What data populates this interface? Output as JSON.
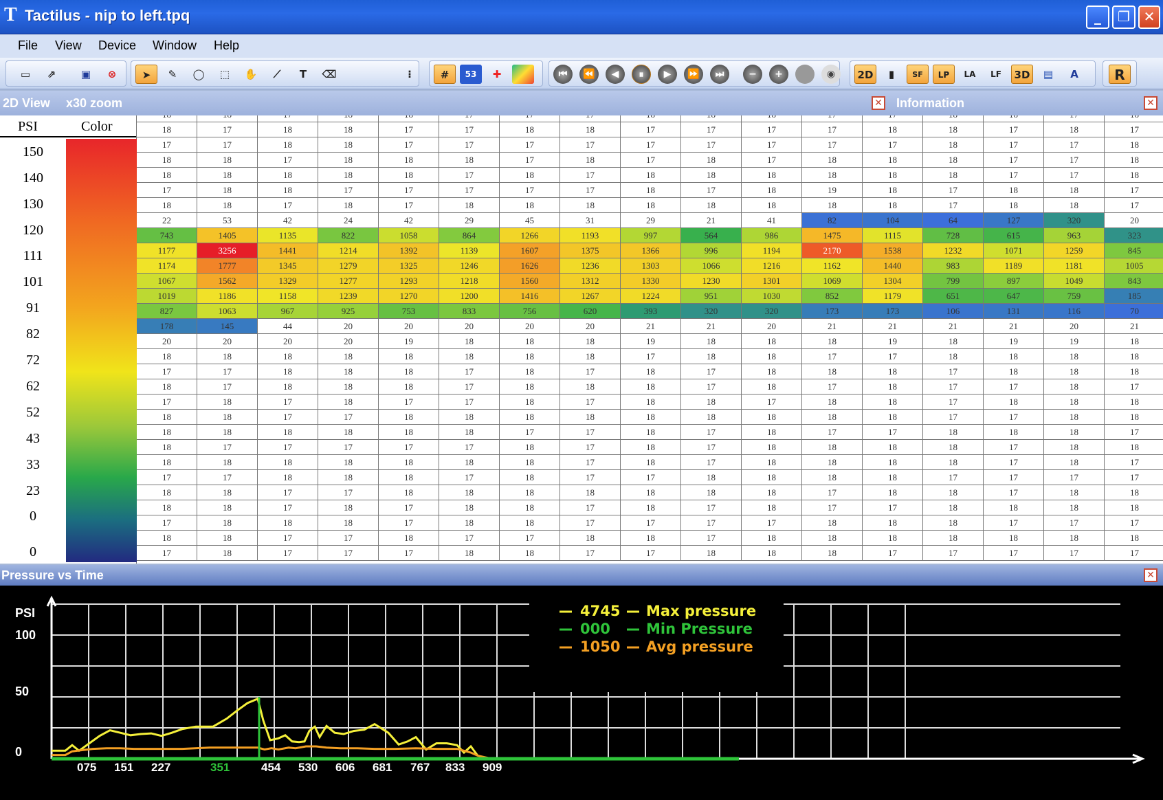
{
  "window": {
    "logo": "T",
    "title": "Tactilus - nip to left.tpq",
    "min_label": "_",
    "max_label": "❐",
    "close_label": "✕"
  },
  "menu": [
    "File",
    "View",
    "Device",
    "Window",
    "Help"
  ],
  "toolbar": {
    "file_tools": [
      "new-icon",
      "open-icon",
      "save-icon",
      "stop-icon"
    ],
    "draw_tools": [
      "pointer-icon",
      "pencil-icon",
      "ellipse-icon",
      "rect-select-icon",
      "hand-icon",
      "line-tool-icon",
      "text-tool-icon",
      "eraser-icon"
    ],
    "view_tools": [
      "grid-icon",
      "numbers-icon",
      "crosshair-icon",
      "colormap-icon"
    ],
    "play_tools": [
      "first-icon",
      "rewind-icon",
      "back-icon",
      "pause-icon",
      "play-icon",
      "forward-icon",
      "last-icon",
      "step-back-icon",
      "step-forward-icon",
      "record-icon",
      "eye-icon"
    ],
    "mode_tools": [
      "2D",
      "bar",
      "SF",
      "LP",
      "LA",
      "LF",
      "3D",
      "img",
      "A"
    ],
    "right_tool": "R"
  },
  "panels": {
    "view_title": "2D View",
    "zoom": "x30 zoom",
    "info_title": "Information",
    "close": "✕"
  },
  "legend": {
    "psi_header": "PSI",
    "color_header": "Color",
    "ticks": [
      "150",
      "140",
      "130",
      "120",
      "111",
      "101",
      "91",
      "82",
      "72",
      "62",
      "52",
      "43",
      "33",
      "23",
      "0",
      "0"
    ],
    "colors": [
      "#e8262a",
      "#f06a22",
      "#f3a61e",
      "#f0e41a",
      "#9bc83a",
      "#29a84a",
      "#1b6e80",
      "#222a80"
    ]
  },
  "grid": {
    "rows": [
      [
        "18",
        "18",
        "17",
        "18",
        "18",
        "17",
        "17",
        "17",
        "18",
        "18",
        "18",
        "17",
        "17",
        "18",
        "18",
        "17",
        "18"
      ],
      [
        "18",
        "17",
        "18",
        "18",
        "17",
        "17",
        "18",
        "18",
        "17",
        "17",
        "17",
        "17",
        "18",
        "18",
        "17",
        "18",
        "17"
      ],
      [
        "17",
        "17",
        "18",
        "18",
        "17",
        "17",
        "17",
        "17",
        "17",
        "17",
        "17",
        "17",
        "17",
        "18",
        "17",
        "17",
        "18"
      ],
      [
        "18",
        "18",
        "17",
        "18",
        "18",
        "18",
        "17",
        "18",
        "17",
        "18",
        "17",
        "18",
        "18",
        "18",
        "17",
        "17",
        "18"
      ],
      [
        "18",
        "18",
        "18",
        "18",
        "18",
        "17",
        "18",
        "17",
        "18",
        "18",
        "18",
        "18",
        "18",
        "18",
        "17",
        "17",
        "18"
      ],
      [
        "17",
        "18",
        "18",
        "17",
        "17",
        "17",
        "17",
        "17",
        "18",
        "17",
        "18",
        "19",
        "18",
        "17",
        "18",
        "18",
        "17"
      ],
      [
        "18",
        "18",
        "17",
        "18",
        "17",
        "18",
        "18",
        "18",
        "18",
        "18",
        "18",
        "18",
        "18",
        "17",
        "18",
        "18",
        "17"
      ],
      [
        "22",
        "53",
        "42",
        "24",
        "42",
        "29",
        "45",
        "31",
        "29",
        "21",
        "41",
        "82",
        "104",
        "64",
        "127",
        "320",
        "20"
      ],
      [
        "743",
        "1405",
        "1135",
        "822",
        "1058",
        "864",
        "1266",
        "1193",
        "997",
        "564",
        "986",
        "1475",
        "1115",
        "728",
        "615",
        "963",
        "323"
      ],
      [
        "1177",
        "3256",
        "1441",
        "1214",
        "1392",
        "1139",
        "1607",
        "1375",
        "1366",
        "996",
        "1194",
        "2170",
        "1538",
        "1232",
        "1071",
        "1259",
        "845"
      ],
      [
        "1174",
        "1777",
        "1345",
        "1279",
        "1325",
        "1246",
        "1626",
        "1236",
        "1303",
        "1066",
        "1216",
        "1162",
        "1440",
        "983",
        "1189",
        "1181",
        "1005"
      ],
      [
        "1067",
        "1562",
        "1329",
        "1277",
        "1293",
        "1218",
        "1560",
        "1312",
        "1330",
        "1230",
        "1301",
        "1069",
        "1304",
        "799",
        "897",
        "1049",
        "843"
      ],
      [
        "1019",
        "1186",
        "1158",
        "1239",
        "1270",
        "1200",
        "1416",
        "1267",
        "1224",
        "951",
        "1030",
        "852",
        "1179",
        "651",
        "647",
        "759",
        "185"
      ],
      [
        "827",
        "1063",
        "967",
        "925",
        "753",
        "833",
        "756",
        "620",
        "393",
        "320",
        "320",
        "173",
        "173",
        "106",
        "131",
        "116",
        "70"
      ],
      [
        "178",
        "145",
        "44",
        "20",
        "20",
        "20",
        "20",
        "20",
        "21",
        "21",
        "20",
        "21",
        "21",
        "21",
        "21",
        "20",
        "21"
      ],
      [
        "20",
        "20",
        "20",
        "20",
        "19",
        "18",
        "18",
        "18",
        "19",
        "18",
        "18",
        "18",
        "19",
        "18",
        "19",
        "19",
        "18"
      ],
      [
        "18",
        "18",
        "18",
        "18",
        "18",
        "18",
        "18",
        "18",
        "17",
        "18",
        "18",
        "17",
        "17",
        "18",
        "18",
        "18",
        "18"
      ],
      [
        "17",
        "17",
        "18",
        "18",
        "18",
        "17",
        "18",
        "17",
        "18",
        "17",
        "18",
        "18",
        "18",
        "17",
        "18",
        "18",
        "18"
      ],
      [
        "18",
        "17",
        "18",
        "18",
        "18",
        "17",
        "18",
        "18",
        "18",
        "17",
        "18",
        "17",
        "18",
        "17",
        "17",
        "18",
        "17"
      ],
      [
        "17",
        "18",
        "17",
        "18",
        "17",
        "17",
        "18",
        "17",
        "18",
        "18",
        "17",
        "18",
        "18",
        "17",
        "18",
        "18",
        "18"
      ],
      [
        "18",
        "18",
        "17",
        "17",
        "18",
        "18",
        "18",
        "18",
        "18",
        "18",
        "18",
        "18",
        "18",
        "17",
        "17",
        "18",
        "18"
      ],
      [
        "18",
        "18",
        "18",
        "18",
        "18",
        "18",
        "17",
        "17",
        "18",
        "17",
        "18",
        "17",
        "17",
        "18",
        "18",
        "18",
        "17"
      ],
      [
        "18",
        "17",
        "17",
        "17",
        "17",
        "17",
        "18",
        "17",
        "18",
        "17",
        "18",
        "18",
        "18",
        "18",
        "17",
        "18",
        "18"
      ],
      [
        "18",
        "18",
        "18",
        "18",
        "18",
        "18",
        "18",
        "17",
        "18",
        "17",
        "18",
        "18",
        "18",
        "18",
        "17",
        "18",
        "17"
      ],
      [
        "17",
        "17",
        "18",
        "18",
        "18",
        "17",
        "18",
        "17",
        "17",
        "18",
        "18",
        "18",
        "18",
        "17",
        "17",
        "17",
        "17"
      ],
      [
        "18",
        "18",
        "17",
        "17",
        "18",
        "18",
        "18",
        "18",
        "18",
        "18",
        "18",
        "17",
        "18",
        "18",
        "17",
        "18",
        "18"
      ],
      [
        "18",
        "18",
        "17",
        "18",
        "17",
        "18",
        "18",
        "17",
        "18",
        "17",
        "18",
        "17",
        "17",
        "18",
        "18",
        "18",
        "18"
      ],
      [
        "17",
        "18",
        "18",
        "18",
        "17",
        "18",
        "18",
        "17",
        "17",
        "17",
        "17",
        "18",
        "18",
        "18",
        "17",
        "17",
        "17"
      ],
      [
        "18",
        "18",
        "17",
        "17",
        "18",
        "17",
        "17",
        "18",
        "18",
        "17",
        "18",
        "18",
        "18",
        "18",
        "18",
        "18",
        "18"
      ],
      [
        "17",
        "18",
        "17",
        "17",
        "17",
        "18",
        "18",
        "17",
        "17",
        "18",
        "18",
        "18",
        "17",
        "17",
        "17",
        "17",
        "17"
      ]
    ]
  },
  "chart": {
    "title": "Pressure vs Time",
    "close": "✕"
  },
  "chart_data": {
    "type": "line",
    "ylabel": "PSI",
    "yticks": [
      "100",
      "50",
      "0"
    ],
    "xticks": [
      "075",
      "151",
      "227",
      "351",
      "454",
      "530",
      "606",
      "681",
      "767",
      "833",
      "909"
    ],
    "highlight_tick": "351",
    "ylim": [
      0,
      100
    ],
    "xlim": [
      0,
      1360
    ],
    "legend": [
      {
        "value": "4745",
        "label": "Max pressure",
        "color": "#f5f03a"
      },
      {
        "value": "000",
        "label": "Min Pressure",
        "color": "#2fc43a"
      },
      {
        "value": "1050",
        "label": "Avg pressure",
        "color": "#f4a023"
      }
    ],
    "series": [
      {
        "name": "Max pressure",
        "color": "#f5f03a",
        "x": [
          0,
          20,
          30,
          40,
          55,
          70,
          85,
          100,
          115,
          130,
          145,
          160,
          175,
          190,
          210,
          235,
          255,
          270,
          285,
          300,
          308,
          318,
          330,
          340,
          350,
          360,
          368,
          375,
          383,
          390,
          400,
          412,
          425,
          440,
          455,
          470,
          490,
          505,
          518,
          530,
          545,
          560,
          575,
          590,
          600,
          610,
          620
        ],
        "y": [
          13,
          13,
          22,
          13,
          25,
          37,
          46,
          42,
          38,
          40,
          41,
          37,
          42,
          48,
          52,
          52,
          65,
          78,
          90,
          97,
          62,
          30,
          33,
          38,
          28,
          27,
          28,
          45,
          52,
          35,
          53,
          42,
          40,
          45,
          47,
          56,
          42,
          23,
          28,
          35,
          15,
          25,
          25,
          22,
          10,
          20,
          5
        ]
      },
      {
        "name": "Avg pressure",
        "color": "#f4a023",
        "x": [
          0,
          20,
          30,
          45,
          60,
          80,
          100,
          120,
          150,
          190,
          230,
          270,
          300,
          310,
          320,
          330,
          345,
          355,
          370,
          385,
          400,
          420,
          445,
          470,
          500,
          530,
          560,
          590,
          610,
          620,
          640,
          860,
          1000
        ],
        "y": [
          6,
          6,
          12,
          14,
          16,
          17,
          17,
          16,
          16,
          16,
          18,
          18,
          18,
          15,
          17,
          15,
          18,
          17,
          20,
          20,
          18,
          17,
          17,
          16,
          16,
          17,
          16,
          16,
          10,
          5,
          0,
          0,
          0
        ]
      },
      {
        "name": "Min Pressure",
        "color": "#2fc43a",
        "x": [
          0,
          1000
        ],
        "y": [
          0,
          0
        ]
      }
    ],
    "marker_x": 300
  }
}
